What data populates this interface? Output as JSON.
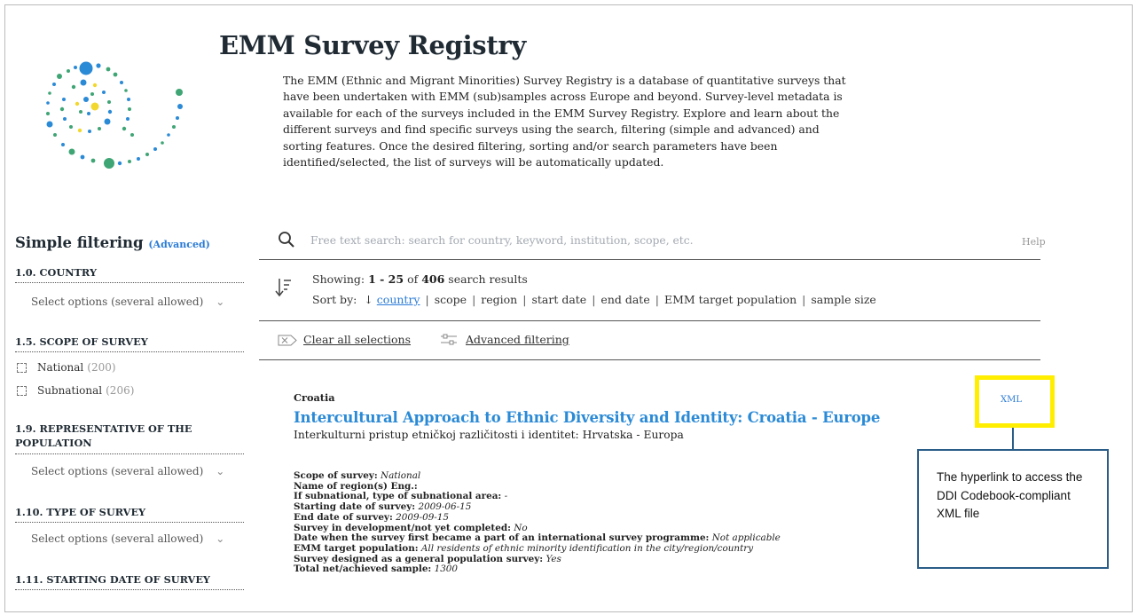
{
  "header": {
    "title": "EMM Survey Registry",
    "intro": "The EMM (Ethnic and Migrant Minorities) Survey Registry is a database of quantitative surveys that have been undertaken with EMM (sub)samples across Europe and beyond. Survey-level metadata is available for each of the surveys included in the EMM Survey Registry. Explore and learn about the different surveys and find specific surveys using the search, filtering (simple and advanced) and sorting features. Once the desired filtering, sorting and/or search parameters have been identified/selected, the list of surveys will be automatically updated."
  },
  "sidebar": {
    "title": "Simple filtering",
    "advanced_link": "(Advanced)",
    "country_head": "1.0. COUNTRY",
    "country_select": "Select options (several allowed)",
    "scope_head": "1.5. SCOPE OF SURVEY",
    "scope_options": [
      {
        "label": "National",
        "count": "(200)"
      },
      {
        "label": "Subnational",
        "count": "(206)"
      }
    ],
    "repr_head": "1.9. REPRESENTATIVE OF THE POPULATION",
    "repr_select": "Select options (several allowed)",
    "type_head": "1.10. TYPE OF SURVEY",
    "type_select": "Select options (several allowed)",
    "start_head": "1.11. STARTING DATE OF SURVEY"
  },
  "search": {
    "placeholder": "Free text search: search for country, keyword, institution, scope, etc.",
    "help": "Help"
  },
  "results": {
    "showing_label": "Showing:",
    "range": "1 - 25",
    "of": "of",
    "total": "406",
    "suffix": "search results",
    "sort_label": "Sort by:",
    "sort_active": "country",
    "sort_options": [
      "scope",
      "region",
      "start date",
      "end date",
      "EMM target population",
      "sample size"
    ],
    "clear_label": "Clear all selections",
    "advanced_label": "Advanced filtering"
  },
  "result_item": {
    "country": "Croatia",
    "title": "Intercultural Approach to Ethnic Diversity and Identity: Croatia - Europe",
    "subtitle": "Interkulturni pristup etničkoj različitosti i identitet: Hrvatska - Europa",
    "xml_link": "XML",
    "meta": [
      {
        "label": "Scope of survey:",
        "value": "National"
      },
      {
        "label": "Name of region(s) Eng.:",
        "value": ""
      },
      {
        "label": "If subnational, type of subnational area:",
        "value": "-"
      },
      {
        "label": "Starting date of survey:",
        "value": "2009-06-15"
      },
      {
        "label": "End date of survey:",
        "value": "2009-09-15"
      },
      {
        "label": "Survey in development/not yet completed:",
        "value": "No"
      },
      {
        "label": "Date when the survey first became a part of an international survey programme:",
        "value": "Not applicable"
      },
      {
        "label": "EMM target population:",
        "value": "All residents of ethnic minority identification in the city/region/country"
      },
      {
        "label": "Survey designed as a general population survey:",
        "value": "Yes"
      },
      {
        "label": "Total net/achieved sample:",
        "value": "1300"
      }
    ]
  },
  "annotation": {
    "text": "The hyperlink  to access the DDI Codebook-compliant XML file",
    "highlight_color": "#ffee00",
    "border_color": "#2a5d88"
  },
  "colors": {
    "link": "#2b7bd6",
    "title": "#2b8ad6"
  }
}
